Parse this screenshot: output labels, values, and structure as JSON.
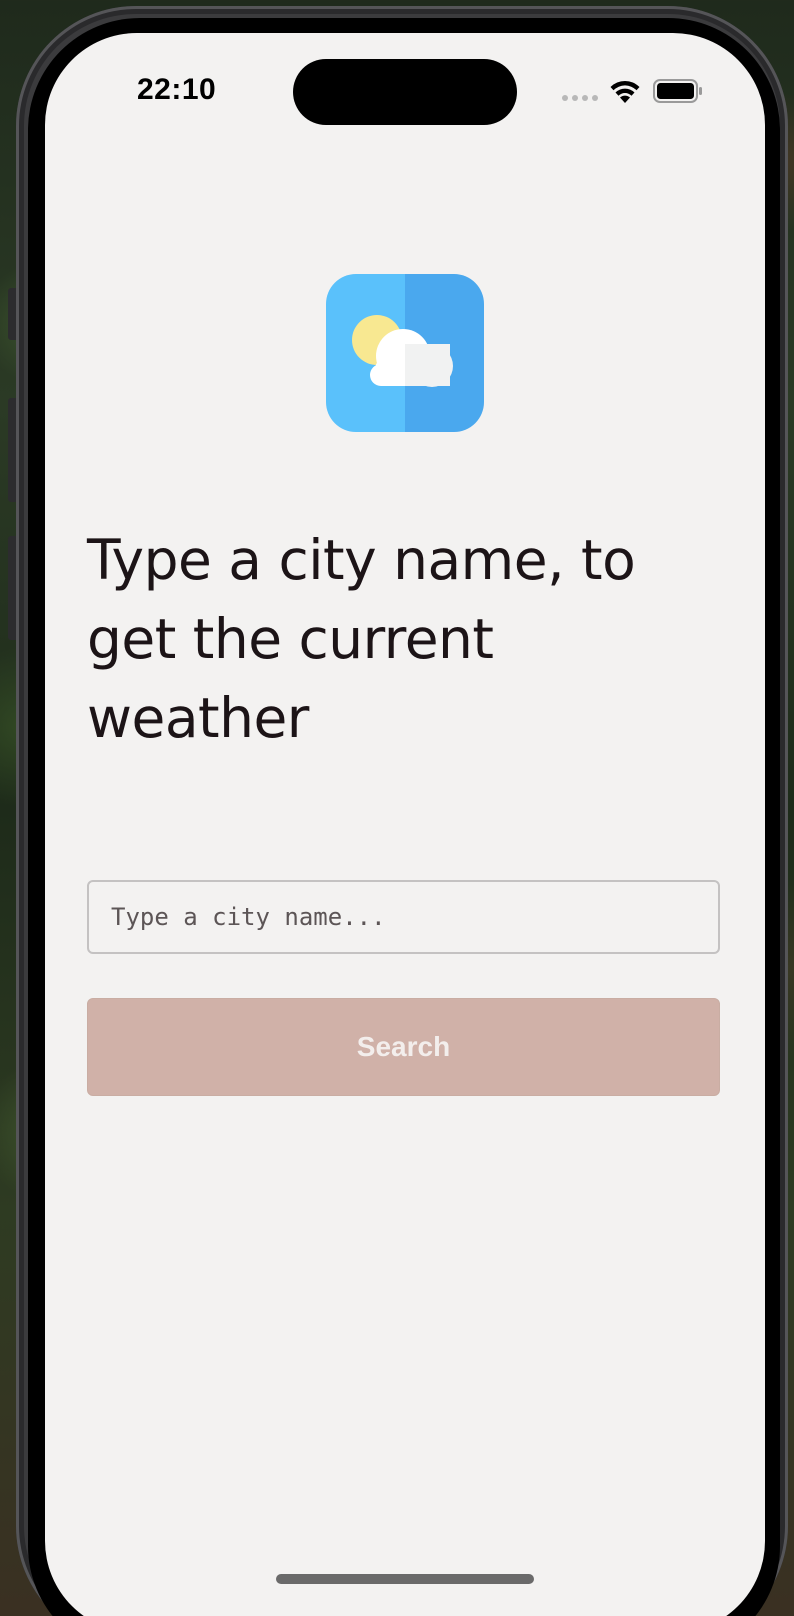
{
  "status_bar": {
    "time": "22:10"
  },
  "app": {
    "icon": "weather-sun-cloud-icon",
    "headline": "Type a city name, to get the current weather",
    "city_input": {
      "value": "",
      "placeholder": "Type a city name..."
    },
    "search_button": {
      "label": "Search",
      "enabled": false
    }
  },
  "colors": {
    "screen_background": "#f3f2f1",
    "button_disabled": "#d0b1a8",
    "icon_blue_light": "#5ac1fb",
    "icon_blue_dark": "#4aa8ee",
    "sun_yellow": "#f8e891"
  }
}
